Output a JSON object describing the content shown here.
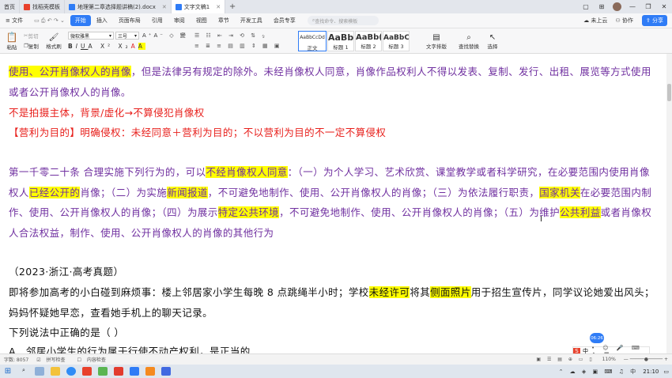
{
  "tabs": {
    "home": "首页",
    "t1": "找稻壳模板",
    "t2": "地理第二章选择题讲稿(2).docx",
    "t3": "文字文稿1"
  },
  "menu": {
    "file": "文件",
    "start": "开始",
    "insert": "插入",
    "layout": "页面布局",
    "ref": "引用",
    "review": "审阅",
    "view": "视图",
    "chapter": "章节",
    "dev": "开发工具",
    "vip": "会员专享",
    "search_placeholder": "查找命令、搜索模板",
    "cloud": "未上云",
    "collab": "协作",
    "share": "分享"
  },
  "ribbon": {
    "paste": "粘贴",
    "cut": "剪切",
    "copy": "复制",
    "format_painter": "格式刷",
    "font": "微软雅黑",
    "size": "三号",
    "styles": [
      {
        "preview": "AaBbCcDd",
        "name": "正文"
      },
      {
        "preview": "AaBb",
        "name": "标题 1"
      },
      {
        "preview": "AaBb(",
        "name": "标题 2"
      },
      {
        "preview": "AaBbC",
        "name": "标题 3"
      }
    ],
    "text_tool": "文字排版",
    "find_replace": "查找替换",
    "select": "选择"
  },
  "doc": {
    "l1": [
      {
        "t": "使用、公开肖像权人的肖像",
        "c": "purple",
        "h": true
      },
      {
        "t": "，但是法律另有规定的除外。未经肖像权人同意，肖像作品权利人不得以发表、复制、发行、出租、展览等方式使用",
        "c": "purple"
      }
    ],
    "l2": [
      {
        "t": "或者公开肖像权人的肖像。",
        "c": "purple"
      }
    ],
    "l3": [
      {
        "t": "不是拍摄主体，背景/虚化→不算侵犯肖像权",
        "c": "red"
      }
    ],
    "l4": [
      {
        "t": "【营利为目的】明确侵权：未经同意＋营利为目的；不以营利为目的不一定不算侵权",
        "c": "red"
      }
    ],
    "l5": [
      {
        "t": "第一千零二十条  合理实施下列行为的，可以",
        "c": "purple"
      },
      {
        "t": "不经肖像权人同意",
        "c": "purple",
        "h": true
      },
      {
        "t": "：（一）为个人学习、艺术欣赏、课堂教学或者科学研究，在必要范围内使用肖像",
        "c": "purple"
      }
    ],
    "l6": [
      {
        "t": "权人",
        "c": "purple"
      },
      {
        "t": "已经公开的",
        "c": "purple",
        "h": true
      },
      {
        "t": "肖像；（二）为实施",
        "c": "purple"
      },
      {
        "t": "新闻报道",
        "c": "purple",
        "h": true
      },
      {
        "t": "，不可避免地制作、使用、公开肖像权人的肖像；（三）为依法履行职责，",
        "c": "purple"
      },
      {
        "t": "国家机关",
        "c": "purple",
        "h": true
      },
      {
        "t": "在必要范围内制",
        "c": "purple"
      }
    ],
    "l7": [
      {
        "t": "作、使用、公开肖像权人的肖像；（四）为展示",
        "c": "purple"
      },
      {
        "t": "特定公共环境",
        "c": "purple",
        "h": true
      },
      {
        "t": "，不可避免地制作、使用、公开肖像权人的肖像；（五）为维护",
        "c": "purple"
      },
      {
        "t": "公共利益",
        "c": "purple",
        "h": true
      },
      {
        "t": "或者肖像权",
        "c": "purple"
      }
    ],
    "l8": [
      {
        "t": "人合法权益，制作、使用、公开肖像权人的肖像的其他行为",
        "c": "purple"
      }
    ],
    "l9": [
      {
        "t": "（2023·浙江·高考真题）",
        "c": "black"
      }
    ],
    "l10": [
      {
        "t": "即将参加高考的小白碰到麻烦事：楼上邻居家小学生每晚 8 点跳绳半小时；学校",
        "c": "black"
      },
      {
        "t": "未经许可",
        "c": "black",
        "h": true
      },
      {
        "t": "将其",
        "c": "black"
      },
      {
        "t": "侧面照片",
        "c": "black",
        "h": true
      },
      {
        "t": "用于招生宣传片，同学议论她爱出风头；",
        "c": "black"
      }
    ],
    "l11": [
      {
        "t": "妈妈怀疑她早恋，查看她手机上的聊天记录。",
        "c": "black"
      }
    ],
    "l12": [
      {
        "t": "下列说法中正确的是（    ）",
        "c": "black"
      }
    ],
    "l13": [
      {
        "t": "A．邻居小学生的行为属于行使不动产权利，是正当的",
        "c": "black"
      }
    ]
  },
  "status": {
    "words": "字数: 8057",
    "spell": "拼写检查",
    "content_check": "内容检查",
    "zoom": "110%",
    "bubble": "06:26"
  },
  "taskbar": {
    "time": "21:10",
    "ime": "中"
  }
}
